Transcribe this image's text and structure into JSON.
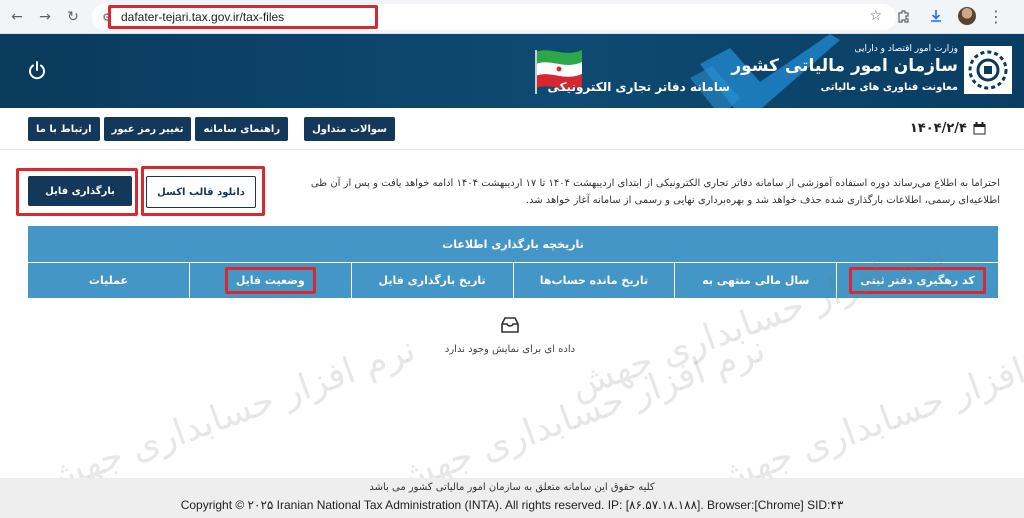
{
  "browser": {
    "url": "dafater-tejari.tax.gov.ir/tax-files"
  },
  "header": {
    "ministry": "وزارت امور اقتصاد و دارایی",
    "org": "سازمان امور مالیاتی کشور",
    "deputy": "معاونت فناوری های مالیاتی",
    "system_title": "سامانه دفاتر تجاری الکترونیکی"
  },
  "toolbar": {
    "date": "۱۴۰۴/۲/۴",
    "nav": [
      "سوالات متداول",
      "راهنمای سامانه",
      "تغییر رمز عبور",
      "ارتباط با ما"
    ]
  },
  "notice": {
    "text": "احتراما به اطلاع می‌رساند دوره استفاده آموزشی از سامانه دفاتر تجاری الکترونیکی از ابتدای اردیبهشت ۱۴۰۴ تا ۱۷ اردیبهشت ۱۴۰۴ ادامه خواهد یافت و پس از آن طی اطلاعیه‌ای رسمی، اطلاعات بارگذاری شده حذف خواهد شد و بهره‌برداری نهایی و رسمی از سامانه آغاز خواهد شد."
  },
  "actions": {
    "download_excel": "دانلود قالب اکسل",
    "upload_file": "بارگذاری فایل"
  },
  "history": {
    "title": "تاریخچه بارگذاری اطلاعات",
    "columns": [
      "کد رهگیری دفتر ثبتی",
      "سال مالی منتهی به",
      "تاریخ مانده حساب‌ها",
      "تاریخ بارگذاری فایل",
      "وضعیت فایل",
      "عملیات"
    ],
    "empty_text": "داده ای برای نمایش وجود ندارد"
  },
  "watermark": {
    "text": "نرم افزار حسابداری جهش"
  },
  "footer": {
    "line1": "کلیه حقوق این سامانه متعلق به سازمان امور مالیاتی کشور می باشد",
    "line2": "Copyright © ۲۰۲۵ Iranian National Tax Administration (INTA). All rights reserved. IP: [۸۶.۵۷.۱۸.۱۸۸]. Browser:[Chrome] SID:۴۳"
  },
  "colors": {
    "header_bg": "#0e4a72",
    "nav_bg": "#13385a",
    "table_header": "#4396c6",
    "highlight": "#d9282f"
  }
}
